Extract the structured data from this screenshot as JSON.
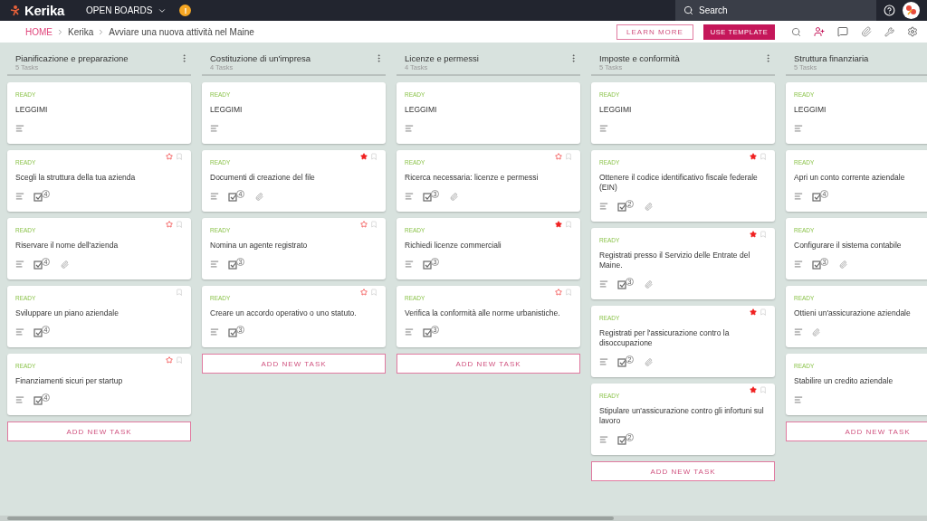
{
  "topbar": {
    "logo": "Kerika",
    "boards_menu": "OPEN BOARDS",
    "alert": "!",
    "search": {
      "placeholder": "Search"
    }
  },
  "breadcrumb": [
    "HOME",
    "Kerika",
    "Avviare una nuova attività nel Maine"
  ],
  "actions": {
    "learn_more": "LEARN MORE",
    "use_template": "USE TEMPLATE"
  },
  "columns": [
    {
      "title": "Pianificazione e preparazione",
      "count": "5 Tasks",
      "menu": true,
      "add": "ADD NEW TASK",
      "cards": [
        {
          "status": "READY",
          "title": "LEGGIMI"
        },
        {
          "status": "READY",
          "title": "Scegli la struttura della tua azienda",
          "starred": false,
          "bookmark": true,
          "checklist": "4"
        },
        {
          "status": "READY",
          "title": "Riservare il nome dell'azienda",
          "starred": false,
          "bookmark": true,
          "checklist": "4",
          "attachment": true
        },
        {
          "status": "READY",
          "title": "Sviluppare un piano aziendale",
          "bookmark": true,
          "checklist": "4"
        },
        {
          "status": "READY",
          "title": "Finanziamenti sicuri per startup",
          "starred": false,
          "bookmark": true,
          "checklist": "4"
        }
      ]
    },
    {
      "title": "Costituzione di un'impresa",
      "count": "4 Tasks",
      "menu": true,
      "add": "ADD NEW TASK",
      "cards": [
        {
          "status": "READY",
          "title": "LEGGIMI"
        },
        {
          "status": "READY",
          "title": "Documenti di creazione del file",
          "starred": true,
          "bookmark": true,
          "checklist": "4",
          "attachment": true
        },
        {
          "status": "READY",
          "title": "Nomina un agente registrato",
          "starred": false,
          "bookmark": true,
          "checklist": "3"
        },
        {
          "status": "READY",
          "title": "Creare un accordo operativo o uno statuto.",
          "starred": false,
          "bookmark": true,
          "checklist": "3"
        }
      ]
    },
    {
      "title": "Licenze e permessi",
      "count": "4 Tasks",
      "menu": true,
      "add": "ADD NEW TASK",
      "cards": [
        {
          "status": "READY",
          "title": "LEGGIMI"
        },
        {
          "status": "READY",
          "title": "Ricerca necessaria: licenze e permessi",
          "starred": false,
          "bookmark": true,
          "checklist": "3",
          "attachment": true
        },
        {
          "status": "READY",
          "title": "Richiedi licenze commerciali",
          "starred": true,
          "bookmark": true,
          "checklist": "3"
        },
        {
          "status": "READY",
          "title": "Verifica la conformità alle norme urbanistiche.",
          "starred": false,
          "bookmark": true,
          "checklist": "3"
        }
      ]
    },
    {
      "title": "Imposte e conformità",
      "count": "5 Tasks",
      "menu": true,
      "add": "ADD NEW TASK",
      "cards": [
        {
          "status": "READY",
          "title": "LEGGIMI"
        },
        {
          "status": "READY",
          "title": "Ottenere il codice identificativo fiscale federale (EIN)",
          "starred": true,
          "bookmark": true,
          "checklist": "2",
          "attachment": true
        },
        {
          "status": "READY",
          "title": "Registrati presso il Servizio delle Entrate del Maine.",
          "starred": true,
          "bookmark": true,
          "checklist": "3",
          "attachment": true
        },
        {
          "status": "READY",
          "title": "Registrati per l'assicurazione contro la disoccupazione",
          "starred": true,
          "bookmark": true,
          "checklist": "2",
          "attachment": true
        },
        {
          "status": "READY",
          "title": "Stipulare un'assicurazione contro gli infortuni sul lavoro",
          "starred": true,
          "bookmark": true,
          "checklist": "2"
        }
      ]
    },
    {
      "title": "Struttura finanziaria",
      "count": "5 Tasks",
      "add": "ADD NEW TASK",
      "cards": [
        {
          "status": "READY",
          "title": "LEGGIMI"
        },
        {
          "status": "READY",
          "title": "Apri un conto corrente aziendale",
          "checklist": "4"
        },
        {
          "status": "READY",
          "title": "Configurare il sistema contabile",
          "checklist": "3",
          "attachment": true
        },
        {
          "status": "READY",
          "title": "Ottieni un'assicurazione aziendale",
          "attachment": true
        },
        {
          "status": "READY",
          "title": "Stabilire un credito aziendale"
        }
      ]
    }
  ]
}
